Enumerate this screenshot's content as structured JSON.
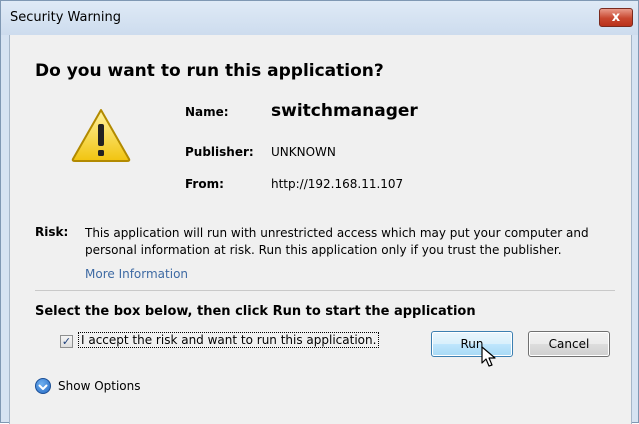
{
  "window": {
    "title": "Security Warning",
    "close_glyph": "x"
  },
  "dialog": {
    "heading": "Do you want to run this application?",
    "icon": "warning-icon",
    "fields": {
      "name_label": "Name:",
      "name_value": "switchmanager",
      "publisher_label": "Publisher:",
      "publisher_value": "UNKNOWN",
      "from_label": "From:",
      "from_value": "http://192.168.11.107"
    },
    "risk_label": "Risk:",
    "risk_text": "This application will run with unrestricted access which may put your computer and personal information at risk. Run this application only if you trust the publisher.",
    "more_info_link": "More Information",
    "select_heading": "Select the box below, then click Run to start the application",
    "accept_checkbox": {
      "checked": true,
      "check_glyph": "✓",
      "label": "I accept the risk and want to run this application."
    },
    "run_button": "Run",
    "cancel_button": "Cancel",
    "show_options": "Show Options"
  },
  "colors": {
    "link": "#3e6aa3",
    "run_button_border": "#3c7fb1",
    "warning_yellow": "#f5d327"
  }
}
